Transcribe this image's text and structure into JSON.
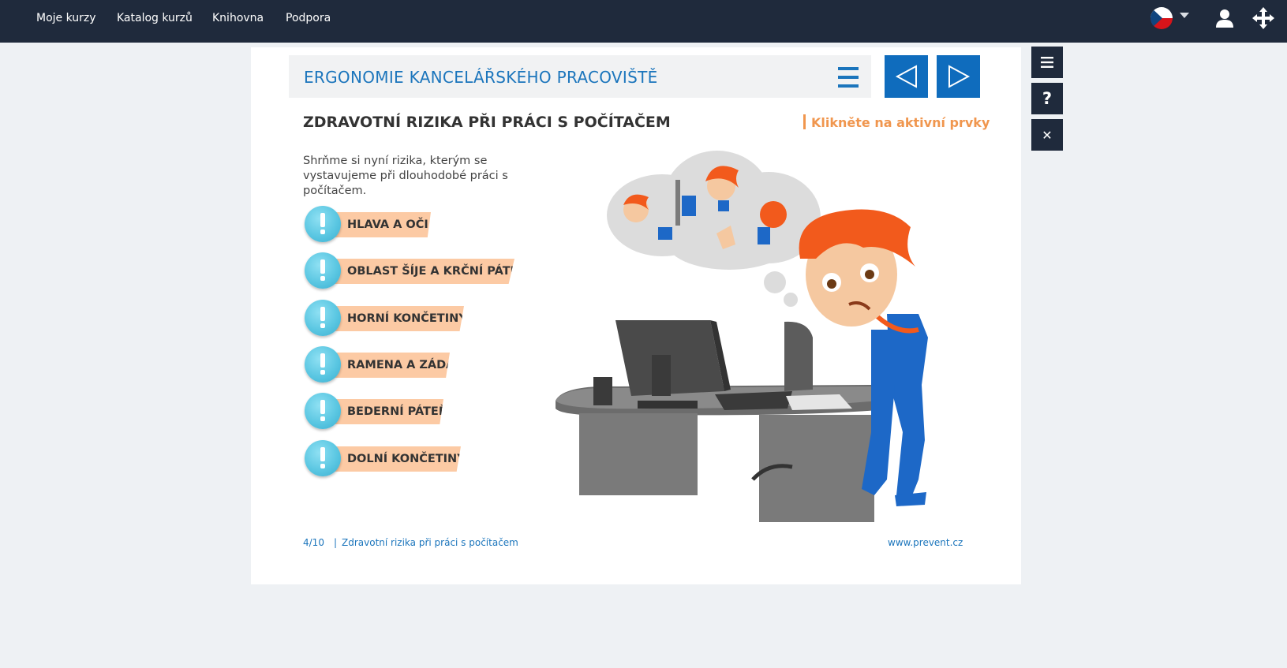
{
  "topnav": {
    "links": [
      "Moje kurzy",
      "Katalog kurzů",
      "Knihovna",
      "Podpora"
    ],
    "language": "cz-flag-icon"
  },
  "sidebar": {
    "buttons": [
      {
        "icon": "menu-icon"
      },
      {
        "icon": "help-icon",
        "label": "?"
      },
      {
        "icon": "close-icon",
        "label": "✕"
      }
    ]
  },
  "course": {
    "title": "ERGONOMIE KANCELÁŘSKÉHO PRACOVIŠTĚ"
  },
  "slide": {
    "title": "ZDRAVOTNÍ RIZIKA PŘI PRÁCI S POČÍTAČEM",
    "hint": "Klikněte na aktivní prvky",
    "intro": "Shrňme si nyní rizika, kterým se vystavujeme při dlouhodobé práci s počítačem.",
    "items": [
      "HLAVA A OČI",
      "OBLAST ŠÍJE A KRČNÍ PÁTEŘE",
      "HORNÍ KONČETINY",
      "RAMENA A ZÁDA",
      "BEDERNÍ PÁTEŘ",
      "DOLNÍ KONČETINY"
    ]
  },
  "footer": {
    "page": "4/10",
    "separator": "|",
    "section": "Zdravotní rizika při práci s počítačem",
    "site": "www.prevent.cz"
  },
  "colors": {
    "navbar": "#1f2a3c",
    "accent_blue": "#0f6cbd",
    "title_blue": "#1b75bc",
    "hint_orange": "#f0964e",
    "tag_peach": "#fccaa4",
    "bubble_cyan": "#5bc7e2"
  }
}
